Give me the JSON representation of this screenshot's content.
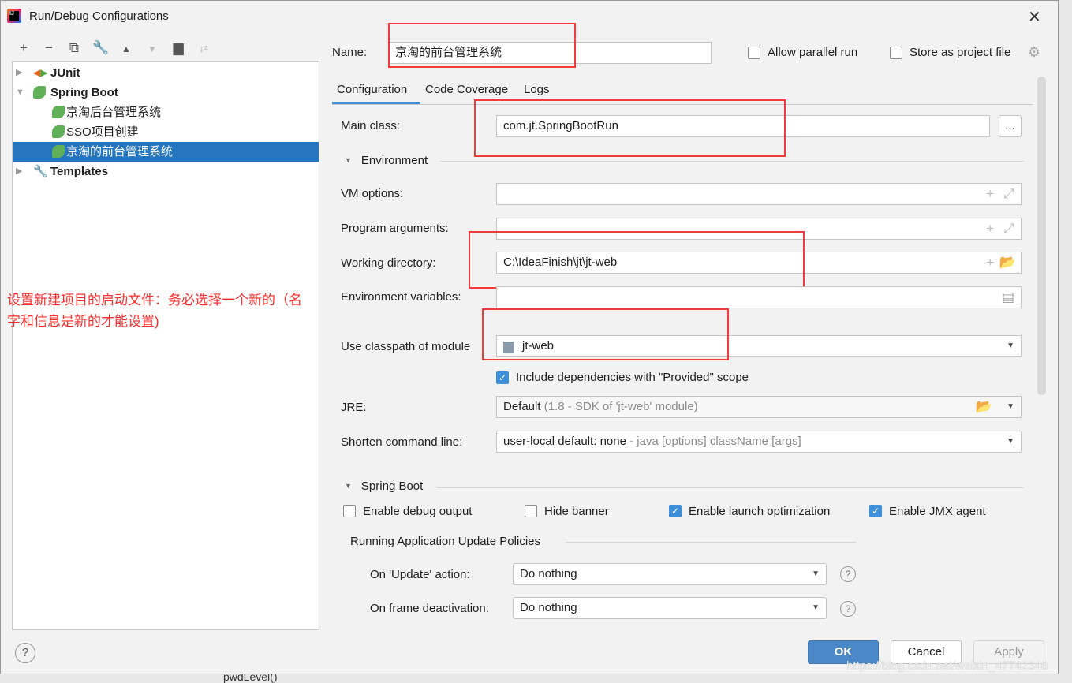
{
  "window": {
    "title": "Run/Debug Configurations",
    "background_text": "pwdLevel()"
  },
  "toolbar": {
    "icons": [
      "plus-icon",
      "minus-icon",
      "copy-icon",
      "wrench-icon",
      "move-up-icon",
      "move-down-icon",
      "new-folder-icon",
      "sort-icon"
    ]
  },
  "tree": [
    {
      "label": "JUnit",
      "level": 0,
      "expanded": false,
      "bold": true
    },
    {
      "label": "Spring Boot",
      "level": 0,
      "expanded": true,
      "bold": true
    },
    {
      "label": "京淘后台管理系统",
      "level": 1
    },
    {
      "label": "SSO项目创建",
      "level": 1
    },
    {
      "label": "京淘的前台管理系统",
      "level": 1,
      "selected": true
    },
    {
      "label": "Templates",
      "level": 0,
      "expanded": false,
      "bold": true
    }
  ],
  "annotation": "设置新建项目的启动文件：务必选择一个新的（名字和信息是新的才能设置)",
  "name_label": "Name:",
  "name_value": "京淘的前台管理系统",
  "allow_parallel": {
    "label": "Allow parallel run",
    "checked": false
  },
  "store_project": {
    "label": "Store as project file",
    "checked": false
  },
  "tabs": [
    "Configuration",
    "Code Coverage",
    "Logs"
  ],
  "active_tab": "Configuration",
  "form": {
    "main_class_label": "Main class:",
    "main_class": "com.jt.SpringBootRun",
    "browse": "...",
    "environment": "Environment",
    "vm_options_label": "VM options:",
    "vm_options": "",
    "program_args_label": "Program arguments:",
    "program_args": "",
    "working_dir_label": "Working directory:",
    "working_dir": "C:\\IdeaFinish\\jt\\jt-web",
    "env_vars_label": "Environment variables:",
    "env_vars": "",
    "classpath_label": "Use classpath of module",
    "classpath": "jt-web",
    "include_deps": {
      "label": "Include dependencies with \"Provided\" scope",
      "checked": true
    },
    "jre_label": "JRE:",
    "jre": "Default",
    "jre_hint": "(1.8 - SDK of 'jt-web' module)",
    "shorten_label": "Shorten command line:",
    "shorten": "user-local default: none",
    "shorten_hint": "- java [options] className [args]"
  },
  "spring_boot": {
    "title": "Spring Boot",
    "debug_output": {
      "label": "Enable debug output",
      "checked": false
    },
    "hide_banner": {
      "label": "Hide banner",
      "checked": false
    },
    "launch_opt": {
      "label": "Enable launch optimization",
      "checked": true
    },
    "jmx": {
      "label": "Enable JMX agent",
      "checked": true
    },
    "policies_title": "Running Application Update Policies",
    "update_label": "On 'Update' action:",
    "update_value": "Do nothing",
    "frame_label": "On frame deactivation:",
    "frame_value": "Do nothing"
  },
  "buttons": {
    "ok": "OK",
    "cancel": "Cancel",
    "apply": "Apply",
    "help": "?"
  },
  "watermark": "https://blog.csdn.net/weixin_47742346",
  "colors": {
    "accent": "#2675bf",
    "annotation": "#ff2a2a",
    "ok": "#4a88c7"
  }
}
